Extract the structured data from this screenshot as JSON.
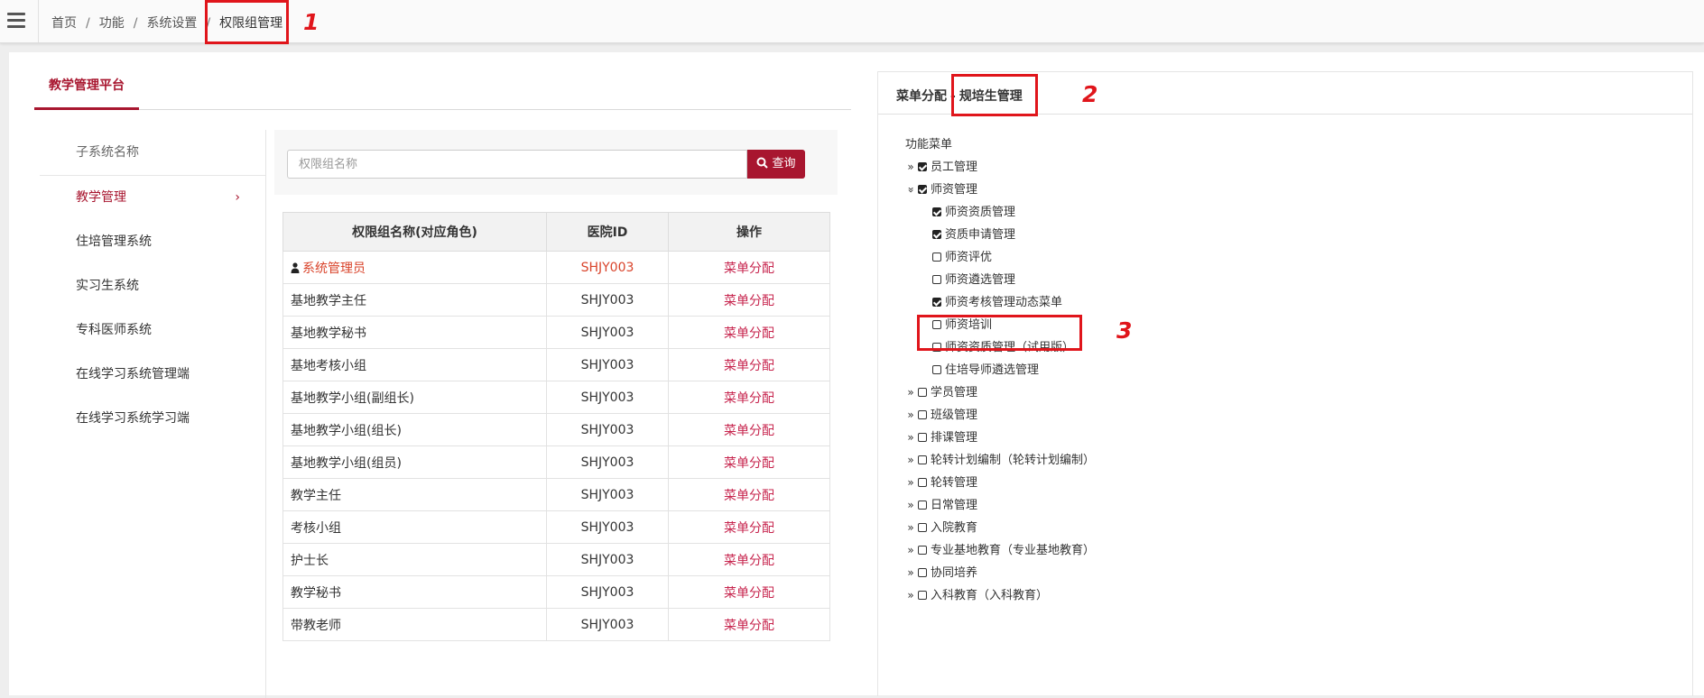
{
  "topbar": {
    "breadcrumb": [
      "首页",
      "功能",
      "系统设置",
      "权限组管理"
    ],
    "separator": "/"
  },
  "annotations": [
    "1",
    "2",
    "3"
  ],
  "left": {
    "tab_label": "教学管理平台",
    "subsystem_header": "子系统名称",
    "subsystems": [
      {
        "label": "教学管理",
        "active": true
      },
      {
        "label": "住培管理系统"
      },
      {
        "label": "实习生系统"
      },
      {
        "label": "专科医师系统"
      },
      {
        "label": "在线学习系统管理端"
      },
      {
        "label": "在线学习系统学习端"
      }
    ],
    "search": {
      "placeholder": "权限组名称",
      "value": "",
      "button_label": "查询",
      "button_icon": "search-icon"
    },
    "table": {
      "columns": [
        "权限组名称(对应角色)",
        "医院ID",
        "操作"
      ],
      "rows": [
        {
          "name": "系统管理员",
          "hospital_id": "SHJY003",
          "action": "菜单分配",
          "highlight": true,
          "icon": "user-icon"
        },
        {
          "name": "基地教学主任",
          "hospital_id": "SHJY003",
          "action": "菜单分配"
        },
        {
          "name": "基地教学秘书",
          "hospital_id": "SHJY003",
          "action": "菜单分配"
        },
        {
          "name": "基地考核小组",
          "hospital_id": "SHJY003",
          "action": "菜单分配"
        },
        {
          "name": "基地教学小组(副组长)",
          "hospital_id": "SHJY003",
          "action": "菜单分配"
        },
        {
          "name": "基地教学小组(组长)",
          "hospital_id": "SHJY003",
          "action": "菜单分配"
        },
        {
          "name": "基地教学小组(组员)",
          "hospital_id": "SHJY003",
          "action": "菜单分配"
        },
        {
          "name": "教学主任",
          "hospital_id": "SHJY003",
          "action": "菜单分配"
        },
        {
          "name": "考核小组",
          "hospital_id": "SHJY003",
          "action": "菜单分配"
        },
        {
          "name": "护士长",
          "hospital_id": "SHJY003",
          "action": "菜单分配"
        },
        {
          "name": "教学秘书",
          "hospital_id": "SHJY003",
          "action": "菜单分配"
        },
        {
          "name": "带教老师",
          "hospital_id": "SHJY003",
          "action": "菜单分配"
        }
      ]
    }
  },
  "right": {
    "title_prefix": "菜单分配",
    "title_dash": "-",
    "title_role": "规培生管理",
    "tree_root": "功能菜单",
    "tree": [
      {
        "label": "员工管理",
        "checked": true,
        "expanded": false,
        "level": 1
      },
      {
        "label": "师资管理",
        "checked": true,
        "expanded": true,
        "level": 1
      },
      {
        "label": "师资资质管理",
        "checked": true,
        "level": 2
      },
      {
        "label": "资质申请管理",
        "checked": true,
        "level": 2
      },
      {
        "label": "师资评优",
        "checked": false,
        "level": 2
      },
      {
        "label": "师资遴选管理",
        "checked": false,
        "level": 2
      },
      {
        "label": "师资考核管理动态菜单",
        "checked": true,
        "level": 2
      },
      {
        "label": "师资培训",
        "checked": false,
        "level": 2
      },
      {
        "label": "师资资质管理（试用版）",
        "checked": false,
        "level": 2
      },
      {
        "label": "住培导师遴选管理",
        "checked": false,
        "level": 2
      },
      {
        "label": "学员管理",
        "checked": false,
        "expanded": false,
        "level": 1
      },
      {
        "label": "班级管理",
        "checked": false,
        "expanded": false,
        "level": 1
      },
      {
        "label": "排课管理",
        "checked": false,
        "expanded": false,
        "level": 1
      },
      {
        "label": "轮转计划编制（轮转计划编制）",
        "checked": false,
        "expanded": false,
        "level": 1
      },
      {
        "label": "轮转管理",
        "checked": false,
        "expanded": false,
        "level": 1
      },
      {
        "label": "日常管理",
        "checked": false,
        "expanded": false,
        "level": 1
      },
      {
        "label": "入院教育",
        "checked": false,
        "expanded": false,
        "level": 1
      },
      {
        "label": "专业基地教育（专业基地教育）",
        "checked": false,
        "expanded": false,
        "level": 1
      },
      {
        "label": "协同培养",
        "checked": false,
        "expanded": false,
        "level": 1
      },
      {
        "label": "入科教育（入科教育）",
        "checked": false,
        "expanded": false,
        "level": 1
      }
    ]
  },
  "colors": {
    "brand": "#a8162f",
    "highlight_text": "#d9432a",
    "annotation_red": "#e0151b"
  }
}
